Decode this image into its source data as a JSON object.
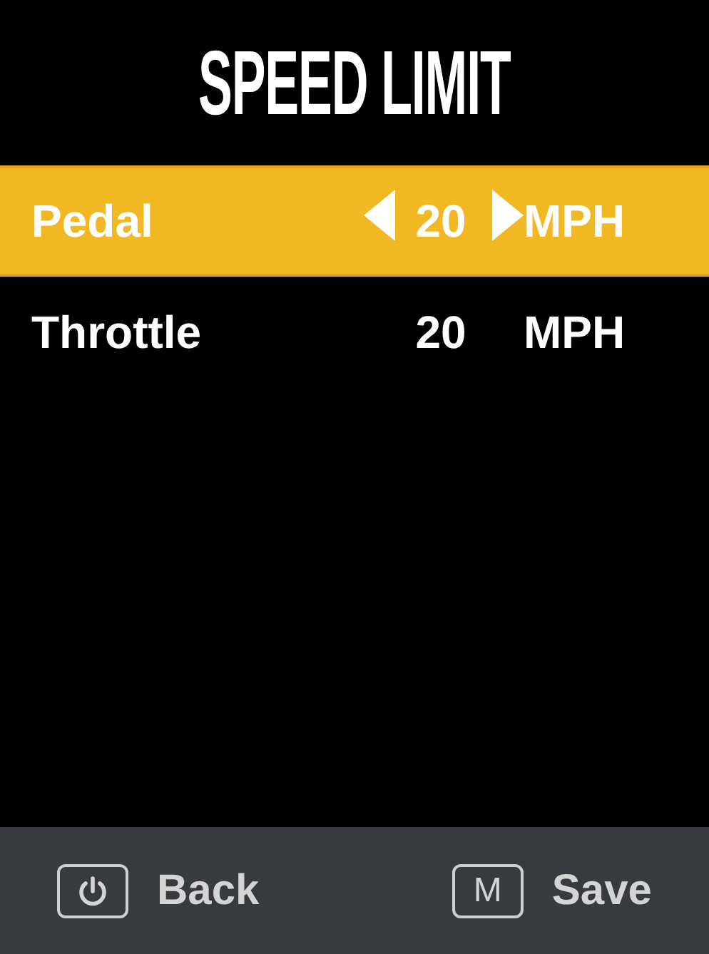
{
  "title": "SPEED LIMIT",
  "settings": [
    {
      "label": "Pedal",
      "value": "20",
      "unit": "MPH",
      "selected": true
    },
    {
      "label": "Throttle",
      "value": "20",
      "unit": "MPH",
      "selected": false
    }
  ],
  "footer": [
    {
      "kind": "power",
      "label": "Back"
    },
    {
      "kind": "key",
      "key": "M",
      "label": "Save"
    }
  ]
}
